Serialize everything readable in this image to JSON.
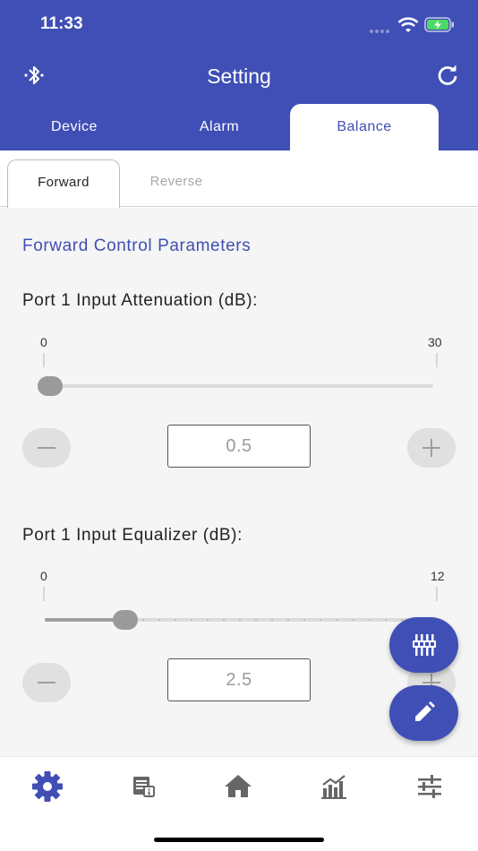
{
  "status_bar": {
    "time": "11:33"
  },
  "header": {
    "title": "Setting",
    "bluetooth_icon": "bluetooth-icon",
    "refresh_icon": "refresh-icon",
    "background": "#3f4fb5"
  },
  "tabs": [
    {
      "label": "Device",
      "active": false
    },
    {
      "label": "Alarm",
      "active": false
    },
    {
      "label": "Balance",
      "active": true
    }
  ],
  "subtabs": [
    {
      "label": "Forward",
      "active": true
    },
    {
      "label": "Reverse",
      "active": false
    }
  ],
  "section_title": "Forward Control Parameters",
  "params": [
    {
      "label": "Port 1 Input Attenuation (dB):",
      "min": "0",
      "max": "30",
      "value": "0.5",
      "level": 0.017
    },
    {
      "label": "Port 1 Input Equalizer (dB):",
      "min": "0",
      "max": "12",
      "value": "2.5",
      "level": 0.208
    }
  ],
  "fabs": [
    {
      "icon": "equalizer-settings-icon"
    },
    {
      "icon": "pencil-edit-icon"
    }
  ],
  "bottom_nav": [
    {
      "icon": "gear-icon",
      "active": true
    },
    {
      "icon": "device-info-icon",
      "active": false
    },
    {
      "icon": "home-icon",
      "active": false
    },
    {
      "icon": "chart-icon",
      "active": false
    },
    {
      "icon": "sliders-icon",
      "active": false
    }
  ],
  "colors": {
    "accent": "#3f4fb5",
    "inactive_icon": "#666666"
  }
}
